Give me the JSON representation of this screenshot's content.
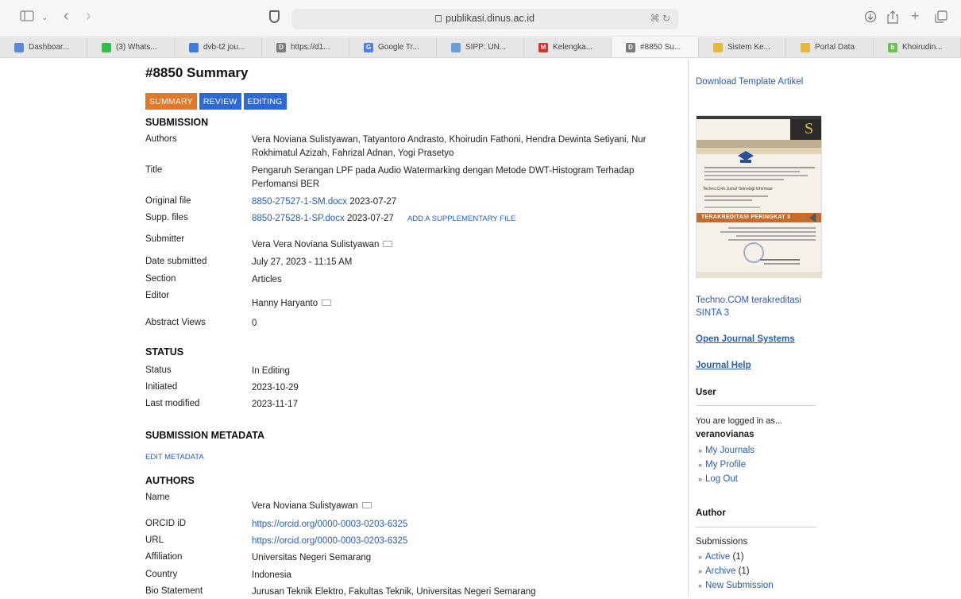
{
  "browser": {
    "address": "publikasi.dinus.ac.id",
    "tabs": [
      {
        "label": "Dashboar...",
        "color": "#5b8bd6",
        "glyph": ""
      },
      {
        "label": "(3) Whats...",
        "color": "#2fbf4a",
        "glyph": ""
      },
      {
        "label": "dvb-t2 jou...",
        "color": "#3b7dd8",
        "glyph": ""
      },
      {
        "label": "https://d1...",
        "color": "#7a7a7a",
        "glyph": "D"
      },
      {
        "label": "Google Tr...",
        "color": "#4a7ee8",
        "glyph": "G"
      },
      {
        "label": "SIPP: UN...",
        "color": "#6aa0d8",
        "glyph": ""
      },
      {
        "label": "Kelengka...",
        "color": "#d93025",
        "glyph": "M"
      },
      {
        "label": "#8850 Su...",
        "color": "#7a7a7a",
        "glyph": "D"
      },
      {
        "label": "Sistem Ke...",
        "color": "#e8b73a",
        "glyph": ""
      },
      {
        "label": "Portal Data",
        "color": "#e8b73a",
        "glyph": ""
      },
      {
        "label": "Khoirudin...",
        "color": "#6cc24a",
        "glyph": "b"
      }
    ]
  },
  "page": {
    "title": "#8850 Summary",
    "buttons": {
      "summary": "SUMMARY",
      "review": "REVIEW",
      "editing": "EDITING"
    },
    "submission": {
      "heading": "SUBMISSION",
      "authors_label": "Authors",
      "authors": "Vera Noviana Sulistyawan, Tatyantoro Andrasto, Khoirudin Fathoni, Hendra Dewinta Setiyani, Nur Rokhimatul Azizah, Fahrizal Adnan, Yogi Prasetyo",
      "title_label": "Title",
      "title": "Pengaruh Serangan LPF pada Audio Watermarking dengan Metode DWT-Histogram Terhadap Perfomansi BER",
      "original_file_label": "Original file",
      "original_file": "8850-27527-1-SM.docx",
      "original_file_date": "2023-07-27",
      "supp_files_label": "Supp. files",
      "supp_file": "8850-27528-1-SP.docx",
      "supp_file_date": "2023-07-27",
      "add_supp": "ADD A SUPPLEMENTARY FILE",
      "submitter_label": "Submitter",
      "submitter": "Vera Vera Noviana Sulistyawan",
      "date_submitted_label": "Date submitted",
      "date_submitted": "July 27, 2023 - 11:15 AM",
      "section_label": "Section",
      "section": "Articles",
      "editor_label": "Editor",
      "editor": "Hanny Haryanto",
      "abstract_views_label": "Abstract Views",
      "abstract_views": "0"
    },
    "status": {
      "heading": "STATUS",
      "status_label": "Status",
      "status": "In Editing",
      "initiated_label": "Initiated",
      "initiated": "2023-10-29",
      "last_modified_label": "Last modified",
      "last_modified": "2023-11-17"
    },
    "metadata": {
      "heading": "SUBMISSION METADATA",
      "edit": "EDIT METADATA"
    },
    "authors": {
      "heading": "AUTHORS",
      "name_label": "Name",
      "name": "Vera Noviana Sulistyawan",
      "orcid_label": "ORCID iD",
      "orcid": "https://orcid.org/0000-0003-0203-6325",
      "url_label": "URL",
      "url": "https://orcid.org/0000-0003-0203-6325",
      "affiliation_label": "Affiliation",
      "affiliation": "Universitas Negeri Semarang",
      "country_label": "Country",
      "country": "Indonesia",
      "bio_label": "Bio Statement",
      "bio": "Jurusan Teknik Elektro, Fakultas Teknik, Universitas Negeri Semarang"
    }
  },
  "sidebar": {
    "download_template": "Download Template Artikel",
    "cover_banner": "TERAKREDITASI PERINGKAT 3",
    "cover_journal": "Techno.Com Jurnal Teknologi Informasi",
    "accreditation": "Techno.COM    terakreditasi SINTA 3",
    "ojs": "Open Journal Systems",
    "journal_help": "Journal Help",
    "user_heading": "User",
    "logged_in_as": "You are logged in as...",
    "username": "veranovianas",
    "user_links": [
      "My Journals",
      "My Profile",
      "Log Out"
    ],
    "author_heading": "Author",
    "submissions_label": "Submissions",
    "active": "Active",
    "active_count": "(1)",
    "archive": "Archive",
    "archive_count": "(1)",
    "new_submission": "New Submission"
  }
}
